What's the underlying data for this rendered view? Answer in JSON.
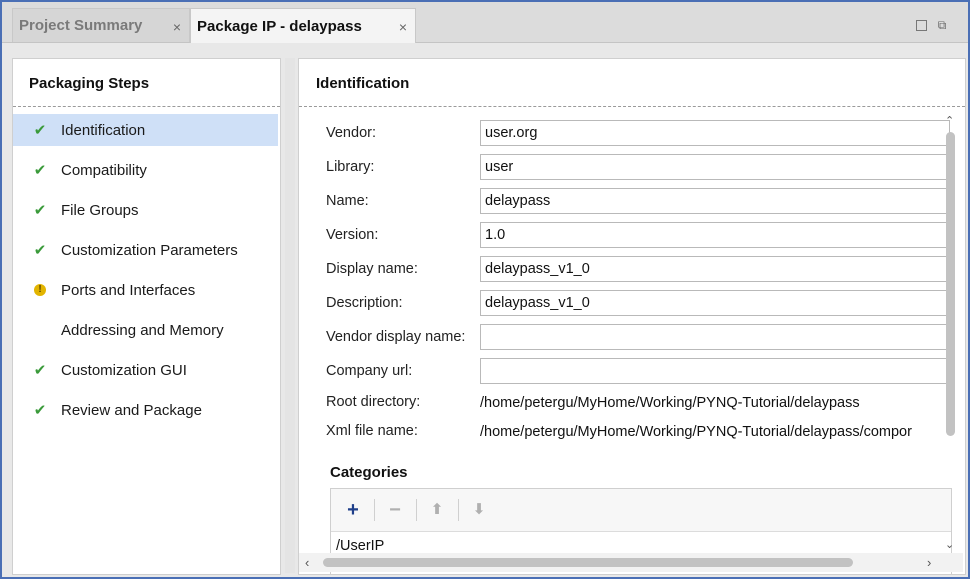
{
  "tabs": [
    {
      "label": "Project Summary",
      "close": "×"
    },
    {
      "label": "Package IP - delaypass",
      "close": "×"
    }
  ],
  "window_buttons": {
    "restore": "",
    "pop": "⧉"
  },
  "steps_panel": {
    "title": "Packaging Steps",
    "items": [
      {
        "label": "Identification",
        "status": "check",
        "glyph": "✔"
      },
      {
        "label": "Compatibility",
        "status": "check",
        "glyph": "✔"
      },
      {
        "label": "File Groups",
        "status": "check",
        "glyph": "✔"
      },
      {
        "label": "Customization Parameters",
        "status": "check",
        "glyph": "✔"
      },
      {
        "label": "Ports and Interfaces",
        "status": "warning",
        "glyph": "!"
      },
      {
        "label": "Addressing and Memory",
        "status": "none",
        "glyph": ""
      },
      {
        "label": "Customization GUI",
        "status": "check",
        "glyph": "✔"
      },
      {
        "label": "Review and Package",
        "status": "check",
        "glyph": "✔"
      }
    ]
  },
  "identification": {
    "title": "Identification",
    "fields": [
      {
        "label": "Vendor:",
        "value": "user.org"
      },
      {
        "label": "Library:",
        "value": "user"
      },
      {
        "label": "Name:",
        "value": "delaypass"
      },
      {
        "label": "Version:",
        "value": "1.0"
      },
      {
        "label": "Display name:",
        "value": "delaypass_v1_0"
      },
      {
        "label": "Description:",
        "value": "delaypass_v1_0"
      },
      {
        "label": "Vendor display name:",
        "value": ""
      },
      {
        "label": "Company url:",
        "value": ""
      }
    ],
    "root_directory": {
      "label": "Root directory:",
      "value": "/home/petergu/MyHome/Working/PYNQ-Tutorial/delaypass"
    },
    "xml_file_name": {
      "label": "Xml file name:",
      "value": "/home/petergu/MyHome/Working/PYNQ-Tutorial/delaypass/compor"
    },
    "categories": {
      "title": "Categories",
      "toolbar": {
        "add": "+",
        "remove": "−",
        "up": "⬆",
        "down": "⬇"
      },
      "items": [
        "/UserIP"
      ]
    }
  },
  "scroll": {
    "up": "⌃",
    "down": "⌄",
    "left": "‹",
    "right": "›"
  }
}
